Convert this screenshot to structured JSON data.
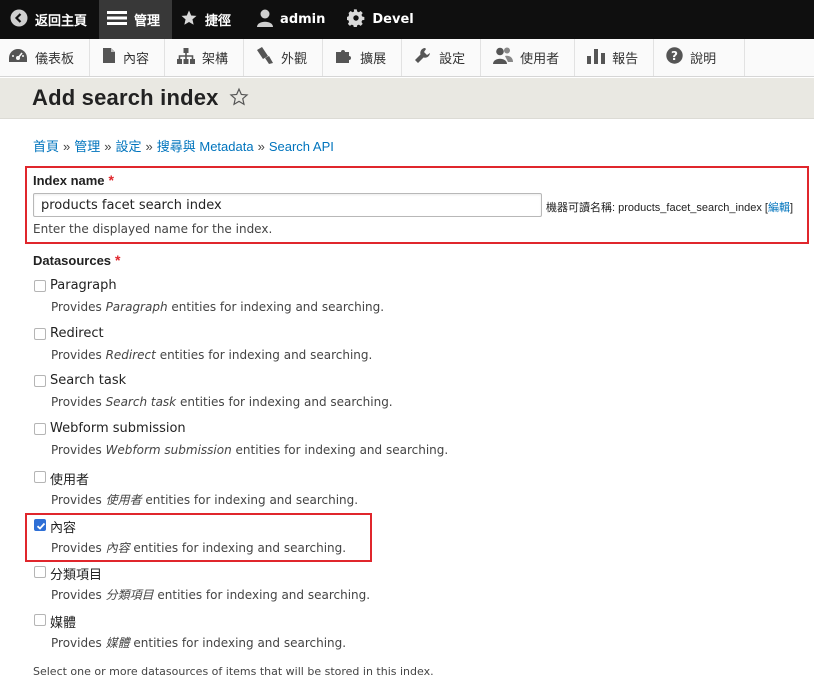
{
  "toolbar": {
    "items": [
      {
        "label": "返回主頁",
        "icon": "arrow-left-circle-icon"
      },
      {
        "label": "管理",
        "icon": "hamburger-menu-icon"
      },
      {
        "label": "捷徑",
        "icon": "star-icon"
      },
      {
        "label": "admin",
        "icon": "user-icon"
      },
      {
        "label": "Devel",
        "icon": "gear-icon"
      }
    ]
  },
  "tray": {
    "items": [
      {
        "label": "儀表板",
        "icon": "dashboard-icon"
      },
      {
        "label": "內容",
        "icon": "document-icon"
      },
      {
        "label": "架構",
        "icon": "structure-icon"
      },
      {
        "label": "外觀",
        "icon": "paintbrush-icon"
      },
      {
        "label": "擴展",
        "icon": "puzzle-icon"
      },
      {
        "label": "設定",
        "icon": "wrench-icon"
      },
      {
        "label": "使用者",
        "icon": "people-icon"
      },
      {
        "label": "報告",
        "icon": "bar-chart-icon"
      },
      {
        "label": "說明",
        "icon": "help-icon"
      }
    ]
  },
  "page": {
    "title": "Add search index"
  },
  "breadcrumb": [
    "首頁",
    "管理",
    "設定",
    "搜尋與 Metadata",
    "Search API"
  ],
  "breadcrumb_separator": "»",
  "index_name": {
    "label": "Index name",
    "required_mark": "*",
    "value": "products facet search index",
    "machine_name_label": "機器可讀名稱: products_facet_search_index",
    "machine_bracket_open": "[",
    "machine_edit_link": "編輯",
    "machine_bracket_close": "]",
    "description": "Enter the displayed name for the index."
  },
  "datasources": {
    "label": "Datasources",
    "required_mark": "*",
    "desc_prefix": "Provides",
    "desc_suffix": "entities for indexing and searching.",
    "items": [
      {
        "label": "Paragraph",
        "checked": false
      },
      {
        "label": "Redirect",
        "checked": false
      },
      {
        "label": "Search task",
        "checked": false
      },
      {
        "label": "Webform submission",
        "checked": false
      },
      {
        "label": "使用者",
        "checked": false
      },
      {
        "label": "內容",
        "checked": true
      },
      {
        "label": "分類項目",
        "checked": false
      },
      {
        "label": "媒體",
        "checked": false
      }
    ],
    "footnote": "Select one or more datasources of items that will be stored in this index."
  },
  "colors": {
    "toolbar_bg": "#0f0f0f",
    "link": "#0074bd",
    "highlight_red": "#e0262c",
    "checkbox_checked": "#2e6fd6"
  }
}
